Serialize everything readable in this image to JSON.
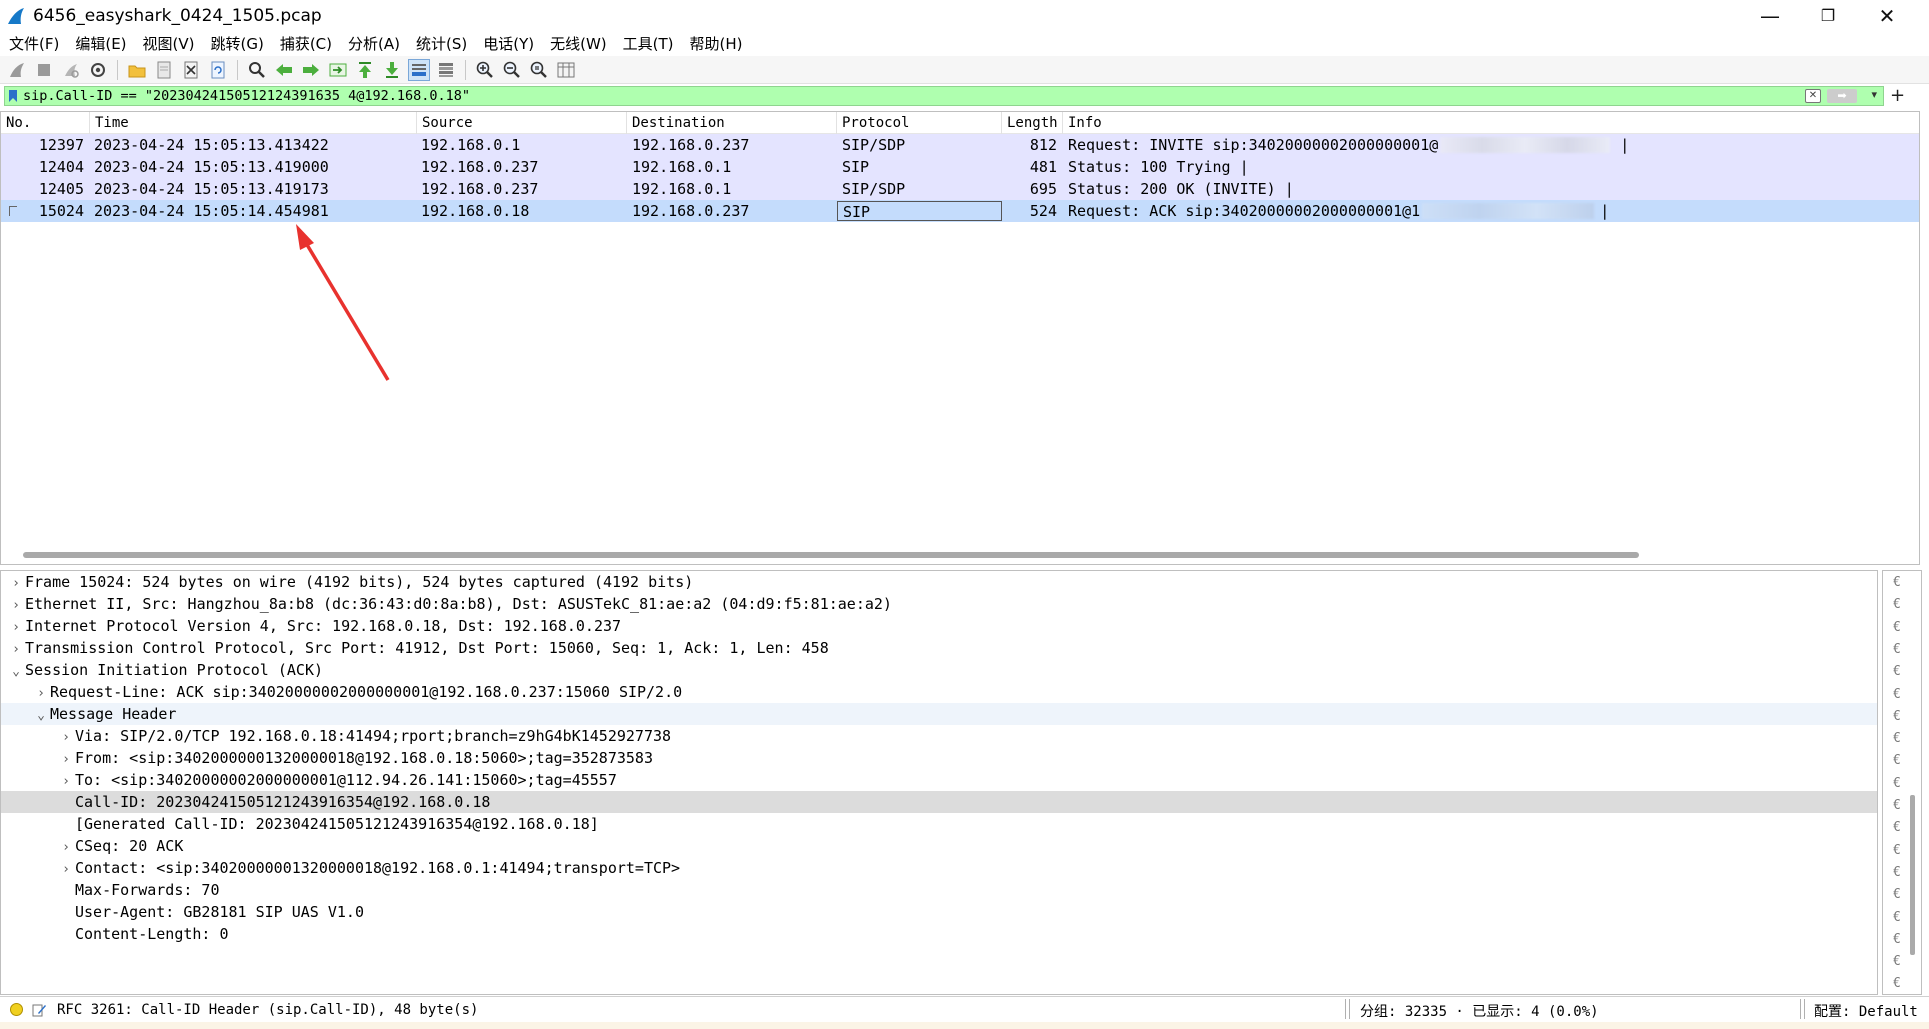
{
  "window": {
    "title": "6456_easyshark_0424_1505.pcap",
    "minimize": "—",
    "maximize": "❐",
    "close": "✕"
  },
  "menu": [
    {
      "label": "文件(F)"
    },
    {
      "label": "编辑(E)"
    },
    {
      "label": "视图(V)"
    },
    {
      "label": "跳转(G)"
    },
    {
      "label": "捕获(C)"
    },
    {
      "label": "分析(A)"
    },
    {
      "label": "统计(S)"
    },
    {
      "label": "电话(Y)"
    },
    {
      "label": "无线(W)"
    },
    {
      "label": "工具(T)"
    },
    {
      "label": "帮助(H)"
    }
  ],
  "filter": {
    "value": "sip.Call-ID == \"20230424150512124391635 4@192.168.0.18\"",
    "plus": "+"
  },
  "packet_list": {
    "columns": [
      "No.",
      "Time",
      "Source",
      "Destination",
      "Protocol",
      "Length",
      "Info"
    ],
    "rows": [
      {
        "no": "12397",
        "time": "2023-04-24 15:05:13.413422",
        "source": "192.168.0.1",
        "destination": "192.168.0.237",
        "protocol": "SIP/SDP",
        "length": "812",
        "info": "Request: INVITE sip:34020000002000000001@"
      },
      {
        "no": "12404",
        "time": "2023-04-24 15:05:13.419000",
        "source": "192.168.0.237",
        "destination": "192.168.0.1",
        "protocol": "SIP",
        "length": "481",
        "info": "Status: 100 Trying |"
      },
      {
        "no": "12405",
        "time": "2023-04-24 15:05:13.419173",
        "source": "192.168.0.237",
        "destination": "192.168.0.1",
        "protocol": "SIP/SDP",
        "length": "695",
        "info": "Status: 200 OK (INVITE) |"
      },
      {
        "no": "15024",
        "time": "2023-04-24 15:05:14.454981",
        "source": "192.168.0.18",
        "destination": "192.168.0.237",
        "protocol": "SIP",
        "length": "524",
        "info": "Request: ACK sip:34020000002000000001@1"
      }
    ]
  },
  "details": [
    {
      "indent": 0,
      "arrow": "right",
      "text": "Frame 15024: 524 bytes on wire (4192 bits), 524 bytes captured (4192 bits)"
    },
    {
      "indent": 0,
      "arrow": "right",
      "text": "Ethernet II, Src: Hangzhou_8a:b8 (dc:36:43:d0:8a:b8), Dst: ASUSTekC_81:ae:a2 (04:d9:f5:81:ae:a2)"
    },
    {
      "indent": 0,
      "arrow": "right",
      "text": "Internet Protocol Version 4, Src: 192.168.0.18, Dst: 192.168.0.237"
    },
    {
      "indent": 0,
      "arrow": "right",
      "text": "Transmission Control Protocol, Src Port: 41912, Dst Port: 15060, Seq: 1, Ack: 1, Len: 458"
    },
    {
      "indent": 0,
      "arrow": "down",
      "text": "Session Initiation Protocol (ACK)"
    },
    {
      "indent": 1,
      "arrow": "right",
      "text": "Request-Line: ACK sip:34020000002000000001@192.168.0.237:15060 SIP/2.0"
    },
    {
      "indent": 1,
      "arrow": "down",
      "text": "Message Header"
    },
    {
      "indent": 2,
      "arrow": "right",
      "text": "Via: SIP/2.0/TCP 192.168.0.18:41494;rport;branch=z9hG4bK1452927738"
    },
    {
      "indent": 2,
      "arrow": "right",
      "text": "From: <sip:34020000001320000018@192.168.0.18:5060>;tag=352873583"
    },
    {
      "indent": 2,
      "arrow": "right",
      "text": "To: <sip:34020000002000000001@112.94.26.141:15060>;tag=45557"
    },
    {
      "indent": 2,
      "arrow": "none",
      "text": "Call-ID: 202304241505121243916354@192.168.0.18"
    },
    {
      "indent": 2,
      "arrow": "none",
      "text": "[Generated Call-ID: 202304241505121243916354@192.168.0.18]"
    },
    {
      "indent": 2,
      "arrow": "right",
      "text": "CSeq: 20 ACK"
    },
    {
      "indent": 2,
      "arrow": "right",
      "text": "Contact: <sip:34020000001320000018@192.168.0.1:41494;transport=TCP>"
    },
    {
      "indent": 2,
      "arrow": "none",
      "text": "Max-Forwards: 70"
    },
    {
      "indent": 2,
      "arrow": "none",
      "text": "User-Agent: GB28181 SIP UAS V1.0"
    },
    {
      "indent": 2,
      "arrow": "none",
      "text": "Content-Length: 0"
    }
  ],
  "status": {
    "message": "RFC 3261: Call-ID Header (sip.Call-ID), 48 byte(s)",
    "stats": "分组: 32335 · 已显示: 4 (0.0%)",
    "profile": "配置: Default"
  }
}
